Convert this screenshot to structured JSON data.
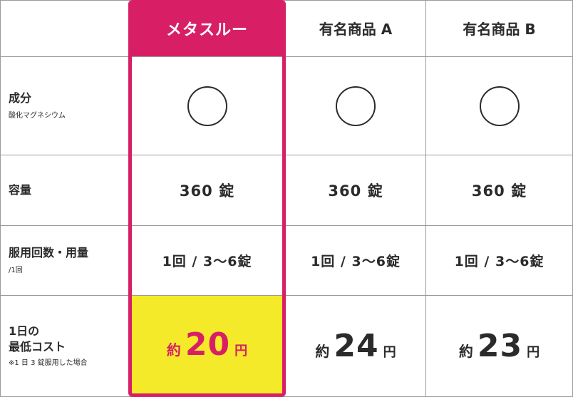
{
  "colors": {
    "accent": "#d81f66",
    "highlight_yellow": "#f5ea2a",
    "text": "#2b2b2b"
  },
  "header": {
    "col1": "メタスルー",
    "col2": "有名商品 A",
    "col3": "有名商品 B"
  },
  "rows": {
    "ingredient": {
      "label": "成分",
      "sub": "酸化マグネシウム",
      "mark": "circle"
    },
    "capacity": {
      "label": "容量",
      "values": [
        "360 錠",
        "360 錠",
        "360 錠"
      ]
    },
    "dosage": {
      "label": "服用回数・用量",
      "sub": "/1回",
      "values": [
        "1回 / 3〜6錠",
        "1回 / 3〜6錠",
        "1回 / 3〜6錠"
      ]
    },
    "cost": {
      "label_line1": "1日の",
      "label_line2": "最低コスト",
      "sub": "※1 日 3 錠服用した場合",
      "prefix": "約",
      "suffix": "円",
      "values": [
        "20",
        "24",
        "23"
      ]
    }
  }
}
